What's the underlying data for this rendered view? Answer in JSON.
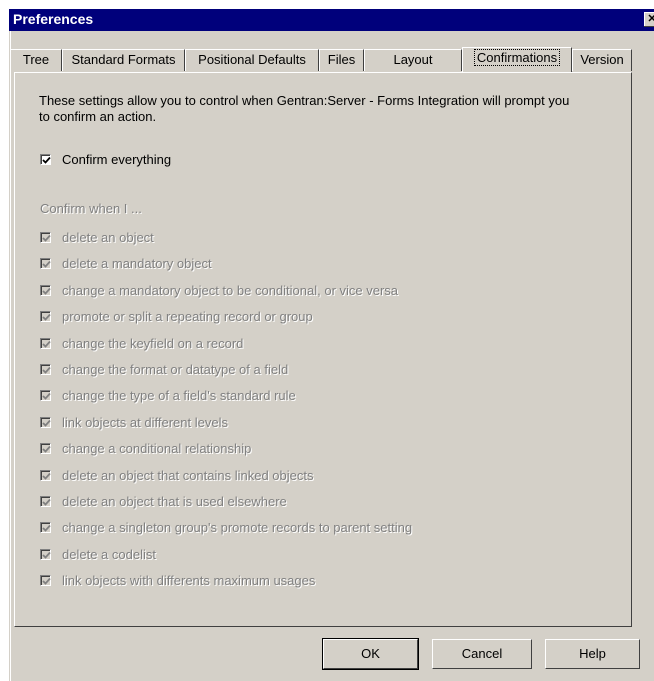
{
  "window": {
    "title": "Preferences",
    "close_glyph": "✕"
  },
  "tabs": [
    {
      "label": "Tree",
      "active": false
    },
    {
      "label": "Standard Formats",
      "active": false
    },
    {
      "label": "Positional Defaults",
      "active": false
    },
    {
      "label": "Files",
      "active": false
    },
    {
      "label": "Layout",
      "active": false
    },
    {
      "label": "Confirmations",
      "active": true
    },
    {
      "label": "Version",
      "active": false
    }
  ],
  "confirmations": {
    "description": "These settings allow you to control when Gentran:Server - Forms Integration will prompt you to confirm an action.",
    "confirm_everything": {
      "label": "Confirm everything",
      "checked": true
    },
    "section_label": "Confirm when I ...",
    "items": [
      {
        "label": "delete an object",
        "checked": true,
        "enabled": false
      },
      {
        "label": "delete a mandatory object",
        "checked": true,
        "enabled": false
      },
      {
        "label": "change a mandatory object to be conditional, or vice versa",
        "checked": true,
        "enabled": false
      },
      {
        "label": "promote or split a repeating record or group",
        "checked": true,
        "enabled": false
      },
      {
        "label": "change the keyfield on a record",
        "checked": true,
        "enabled": false
      },
      {
        "label": "change the format or datatype of a field",
        "checked": true,
        "enabled": false
      },
      {
        "label": "change the type of a field's standard rule",
        "checked": true,
        "enabled": false
      },
      {
        "label": "link objects at different levels",
        "checked": true,
        "enabled": false
      },
      {
        "label": "change a conditional relationship",
        "checked": true,
        "enabled": false
      },
      {
        "label": "delete an object that contains linked objects",
        "checked": true,
        "enabled": false
      },
      {
        "label": "delete an object that is used elsewhere",
        "checked": true,
        "enabled": false
      },
      {
        "label": "change a singleton group's promote records to parent setting",
        "checked": true,
        "enabled": false
      },
      {
        "label": "delete a codelist",
        "checked": true,
        "enabled": false
      },
      {
        "label": "link objects with differents maximum usages",
        "checked": true,
        "enabled": false
      }
    ]
  },
  "buttons": {
    "ok": "OK",
    "cancel": "Cancel",
    "help": "Help"
  },
  "colors": {
    "titlebar": "#00007b",
    "face": "#d4d0c8",
    "disabled_text": "#808080"
  }
}
